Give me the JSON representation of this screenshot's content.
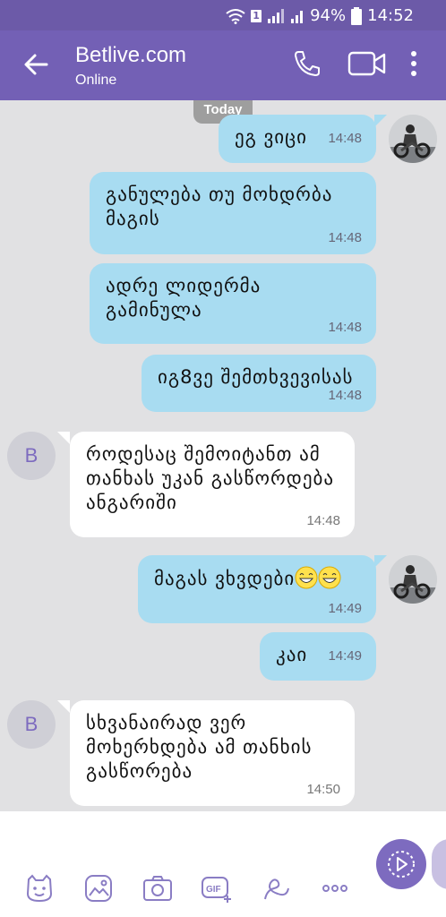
{
  "status": {
    "battery": "94%",
    "time": "14:52",
    "sim": "1"
  },
  "header": {
    "title": "Betlive.com",
    "subtitle": "Online"
  },
  "day_label": "Today",
  "messages": [
    {
      "text": "ეგ ვიცი",
      "time": "14:48",
      "dir": "out"
    },
    {
      "text": "განულება თუ მოხდრბა მაგის",
      "time": "14:48",
      "dir": "out"
    },
    {
      "text": "ადრე ლიდერმა გამინულა",
      "time": "14:48",
      "dir": "out"
    },
    {
      "text": "იგ8ვე შემთხვევისას",
      "time": "14:48",
      "dir": "out"
    },
    {
      "text": "როდესაც შემოიტანთ ამ თანხას უკან გასწორდება ანგარიში",
      "time": "14:48",
      "dir": "in"
    },
    {
      "text": "მაგას ვხვდები",
      "time": "14:49",
      "dir": "out"
    },
    {
      "text": "კაი",
      "time": "14:49",
      "dir": "out"
    },
    {
      "text": "სხვანაირად ვერ მოხერხდება ამ თანხის გასწორება",
      "time": "14:50",
      "dir": "in"
    }
  ],
  "contact_initial": "B",
  "colors": {
    "header": "#7360b5",
    "statusbar": "#6c5aa8",
    "outgoing": "#a8dcf1",
    "incoming": "#ffffff",
    "accent": "#7d6bbf"
  },
  "composer_icons": [
    "sticker-icon",
    "gallery-icon",
    "camera-icon",
    "gif-icon",
    "doodle-icon",
    "more-icon"
  ]
}
